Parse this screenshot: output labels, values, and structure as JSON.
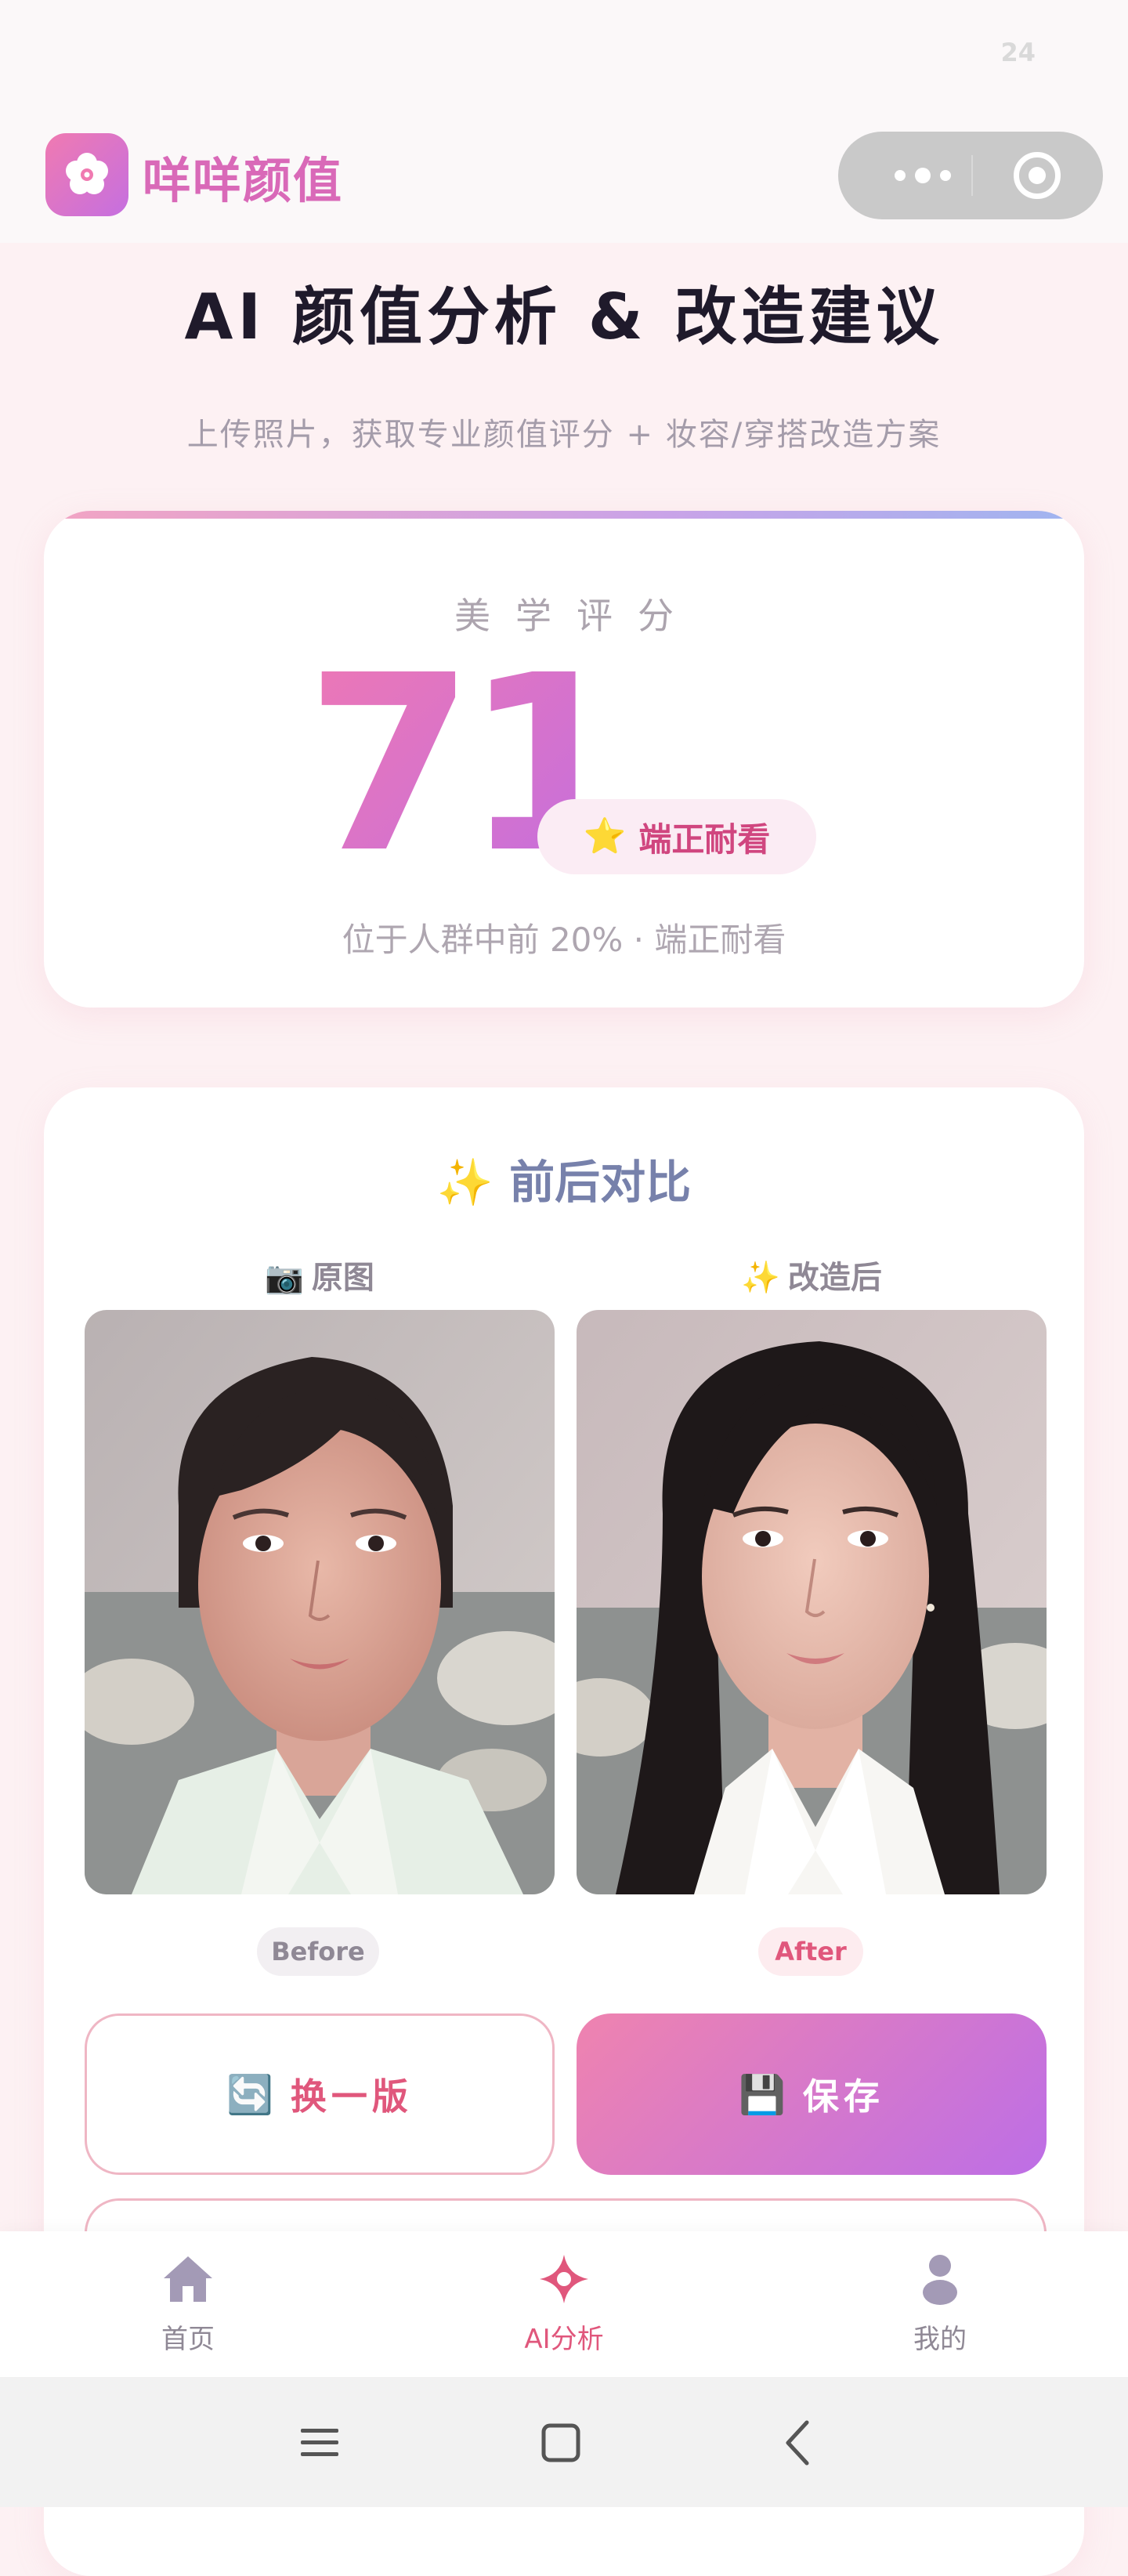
{
  "status_bar": {
    "right_text": "24"
  },
  "header": {
    "app_name": "咩咩颜值",
    "logo_icon": "flower-icon",
    "capsule": {
      "more_icon": "more-dots-icon",
      "close_icon": "target-circle-icon"
    }
  },
  "page": {
    "title": "AI 颜值分析 & 改造建议",
    "subtitle": "上传照片，获取专业颜值评分 + 妆容/穿搭改造方案"
  },
  "score_card": {
    "label": "美学评分",
    "score": "71",
    "badge_icon": "⭐",
    "badge_text": "端正耐看",
    "description": "位于人群中前 20% · 端正耐看",
    "accent_gradient": [
      "#ee78b4",
      "#c26ee0"
    ]
  },
  "compare_card": {
    "title_icon": "✨",
    "title": "前后对比",
    "original": {
      "icon": "📷",
      "label": "原图",
      "tag": "Before"
    },
    "modified": {
      "icon": "✨",
      "label": "改造后",
      "tag": "After"
    },
    "swap_button": {
      "icon": "🔄",
      "label": "换一版"
    },
    "save_button": {
      "icon": "💾",
      "label": "保存"
    }
  },
  "tab_bar": {
    "items": [
      {
        "label": "首页",
        "icon": "home-icon",
        "active": false
      },
      {
        "label": "AI分析",
        "icon": "sparkle-icon",
        "active": true
      },
      {
        "label": "我的",
        "icon": "user-icon",
        "active": false
      }
    ]
  },
  "system_nav": {
    "icons": [
      "menu-icon",
      "home-square-icon",
      "back-icon"
    ]
  },
  "colors": {
    "brand_pink": "#d969b8",
    "active_tab": "#e0577c",
    "page_bg": "#fdf1f3"
  }
}
